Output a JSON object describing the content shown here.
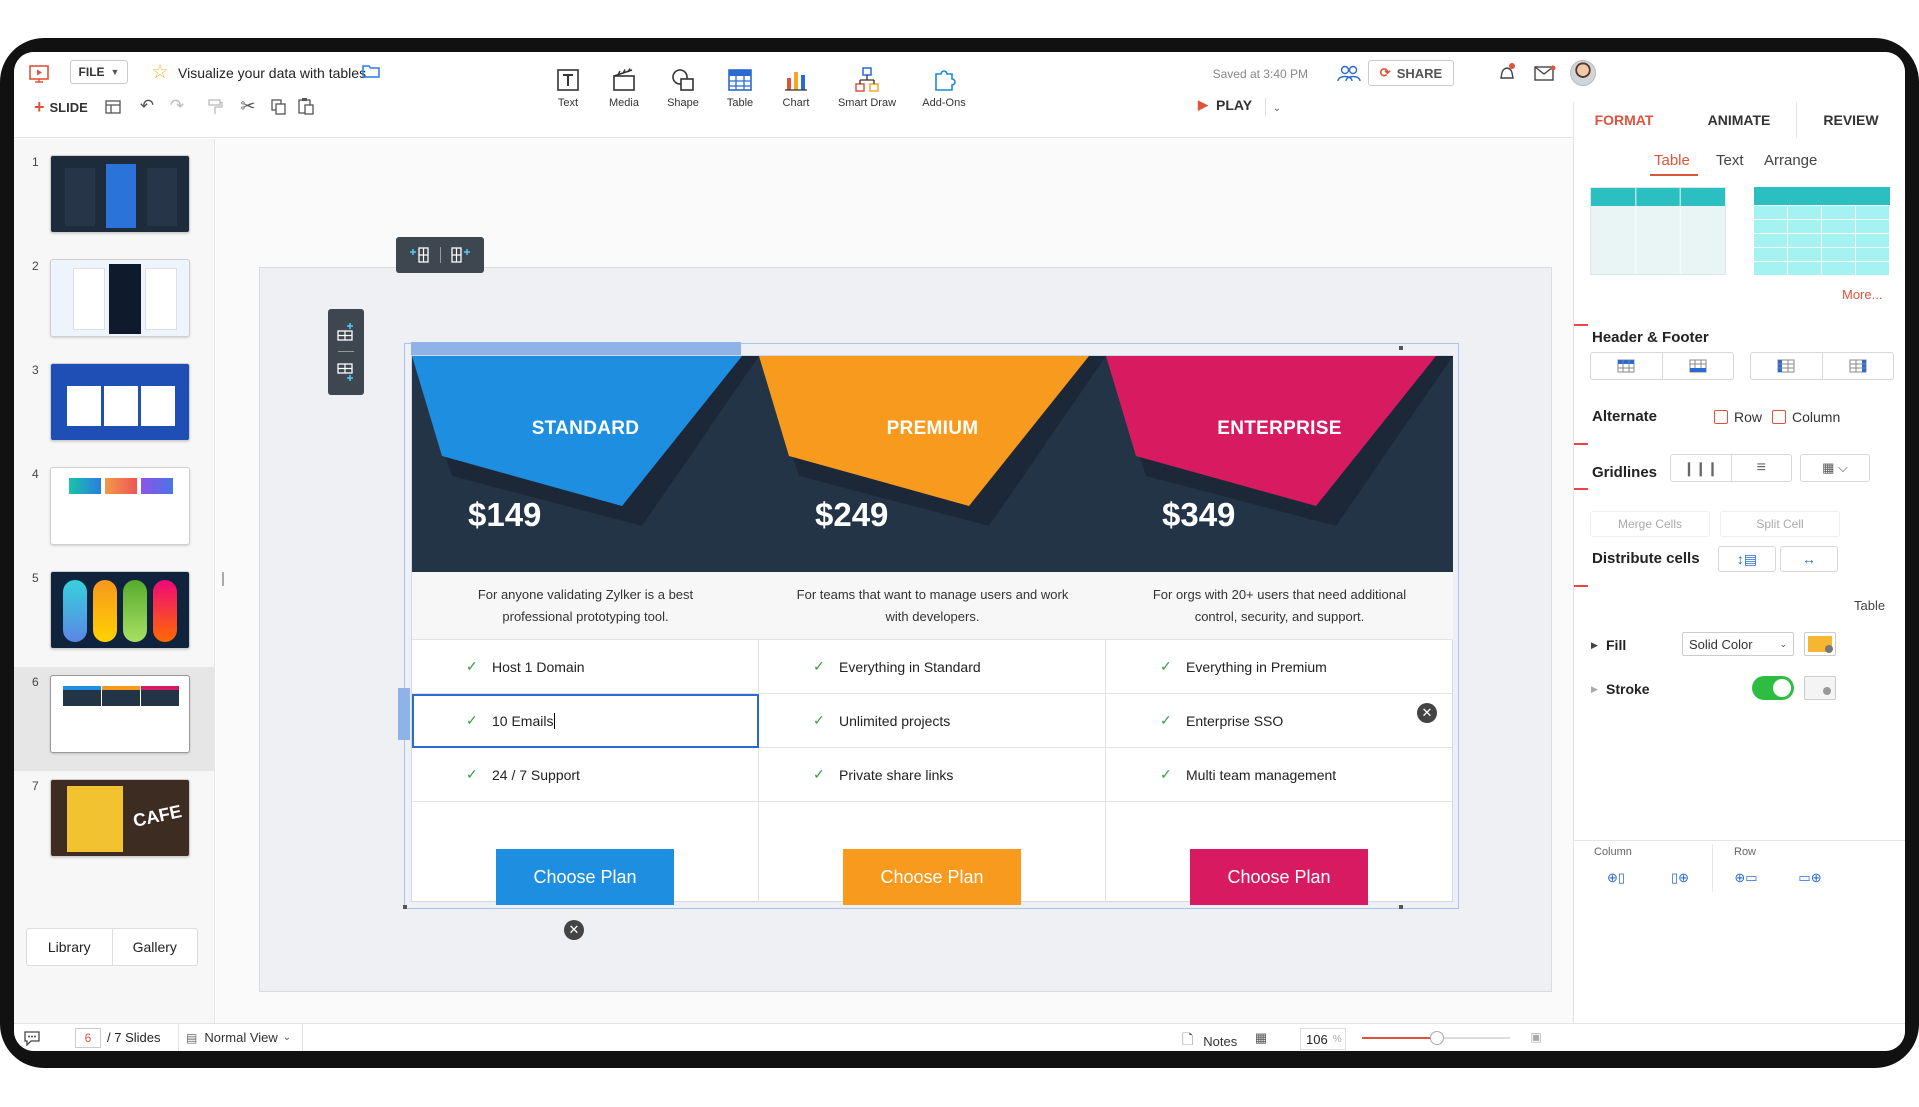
{
  "app": {
    "file_menu": "FILE",
    "doc_title": "Visualize your data with tables",
    "saved_status": "Saved at 3:40 PM",
    "share_label": "SHARE",
    "slide_button": "SLIDE",
    "play_label": "PLAY"
  },
  "toolbar": {
    "tools": [
      {
        "label": "Text",
        "icon": "text-icon"
      },
      {
        "label": "Media",
        "icon": "media-icon"
      },
      {
        "label": "Shape",
        "icon": "shape-icon"
      },
      {
        "label": "Table",
        "icon": "table-icon"
      },
      {
        "label": "Chart",
        "icon": "chart-icon"
      },
      {
        "label": "Smart Draw",
        "icon": "smart-draw-icon"
      },
      {
        "label": "Add-Ons",
        "icon": "add-ons-icon"
      }
    ]
  },
  "slides_panel": {
    "numbers": [
      "1",
      "2",
      "3",
      "4",
      "5",
      "6",
      "7"
    ],
    "selected": 6,
    "library_label": "Library",
    "gallery_label": "Gallery"
  },
  "table": {
    "plans": [
      {
        "name": "STANDARD",
        "price": "$149",
        "desc": "For anyone validating Zylker is a best professional prototyping tool.",
        "features": [
          "Host 1 Domain",
          "10 Emails",
          "24 / 7 Support"
        ],
        "button": "Choose Plan",
        "color": "#1e8fe0"
      },
      {
        "name": "PREMIUM",
        "price": "$249",
        "desc": "For teams that want to manage users and work with developers.",
        "features": [
          "Everything in Standard",
          "Unlimited projects",
          "Private share links"
        ],
        "button": "Choose Plan",
        "color": "#f79a1d"
      },
      {
        "name": "ENTERPRISE",
        "price": "$349",
        "desc": "For orgs with 20+ users that need additional control, security, and support.",
        "features": [
          "Everything in Premium",
          "Enterprise SSO",
          "Multi team management"
        ],
        "button": "Choose Plan",
        "color": "#d81b60"
      }
    ]
  },
  "right_panel": {
    "tabs": [
      "FORMAT",
      "ANIMATE",
      "REVIEW"
    ],
    "subtabs": [
      "Table",
      "Text",
      "Arrange"
    ],
    "more_label": "More...",
    "header_footer": "Header & Footer",
    "alternate": "Alternate",
    "row_label": "Row",
    "column_label": "Column",
    "gridlines": "Gridlines",
    "merge_cells": "Merge Cells",
    "split_cell": "Split Cell",
    "distribute_cells": "Distribute cells",
    "table_label": "Table",
    "fill_label": "Fill",
    "fill_value": "Solid Color",
    "stroke_label": "Stroke",
    "footer_column": "Column",
    "footer_row": "Row",
    "accent": "#e0533b",
    "fill_color": "#f5b731",
    "stroke_on": true
  },
  "status_bar": {
    "current_slide": "6",
    "total_slides": "/ 7 Slides",
    "view_mode": "Normal View",
    "notes_label": "Notes",
    "zoom": "106",
    "zoom_unit": "%"
  }
}
